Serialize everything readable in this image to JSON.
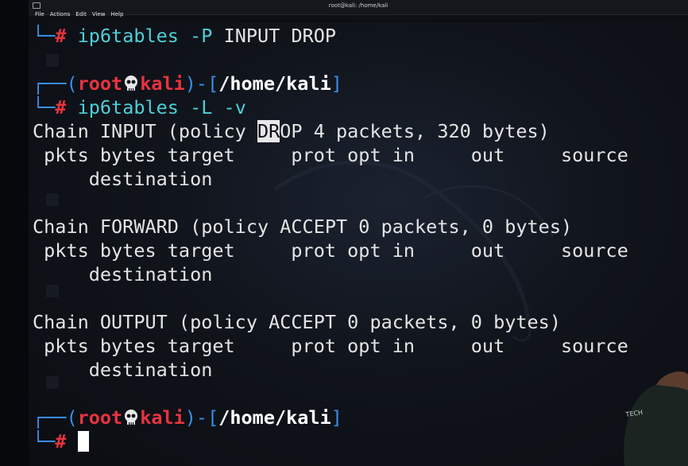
{
  "window": {
    "title": "root@kali: /home/kali",
    "menu": [
      "File",
      "Actions",
      "Edit",
      "View",
      "Help"
    ]
  },
  "prompt": {
    "user": "root",
    "host": "kali",
    "path": "/home/kali",
    "user_color": "#e8333f",
    "bracket_color": "#3a8fe8"
  },
  "terminal": {
    "line1_cmd": "ip6tables",
    "line1_args_flag": "-P",
    "line1_args_rest": "INPUT DROP",
    "line2_cmd": "ip6tables",
    "line2_args": "-L -v",
    "chain_input_before": "Chain INPUT (policy ",
    "chain_input_selected": "DR",
    "chain_input_after": "OP 4 packets, 320 bytes)",
    "header_line": " pkts bytes target     prot opt in     out     source",
    "header_wrap": "     destination",
    "chain_forward": "Chain FORWARD (policy ACCEPT 0 packets, 0 bytes)",
    "chain_output": "Chain OUTPUT (policy ACCEPT 0 packets, 0 bytes)"
  }
}
